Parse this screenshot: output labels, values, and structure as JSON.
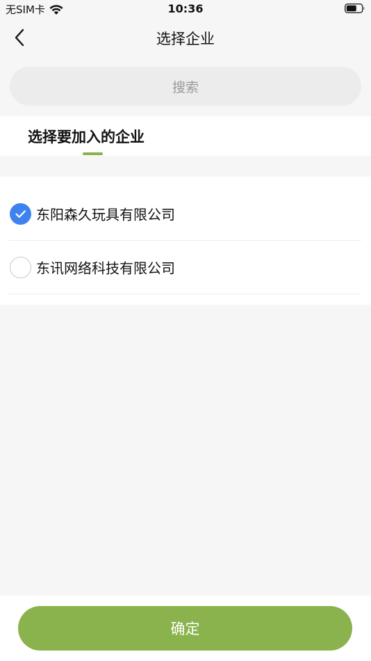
{
  "status_bar": {
    "carrier": "无SIM卡",
    "time": "10:36",
    "wifi_icon": "wifi-icon",
    "battery_icon": "battery-icon"
  },
  "nav": {
    "title": "选择企业",
    "back_icon": "chevron-left-icon"
  },
  "search": {
    "placeholder": "搜索"
  },
  "tab": {
    "label": "选择要加入的企业",
    "accent_color": "#8ab34d"
  },
  "companies": [
    {
      "name": "东阳森久玩具有限公司",
      "selected": true
    },
    {
      "name": "东讯网络科技有限公司",
      "selected": false
    }
  ],
  "selected_color": "#3e82f0",
  "confirm": {
    "label": "确定",
    "color": "#8ab34d"
  }
}
